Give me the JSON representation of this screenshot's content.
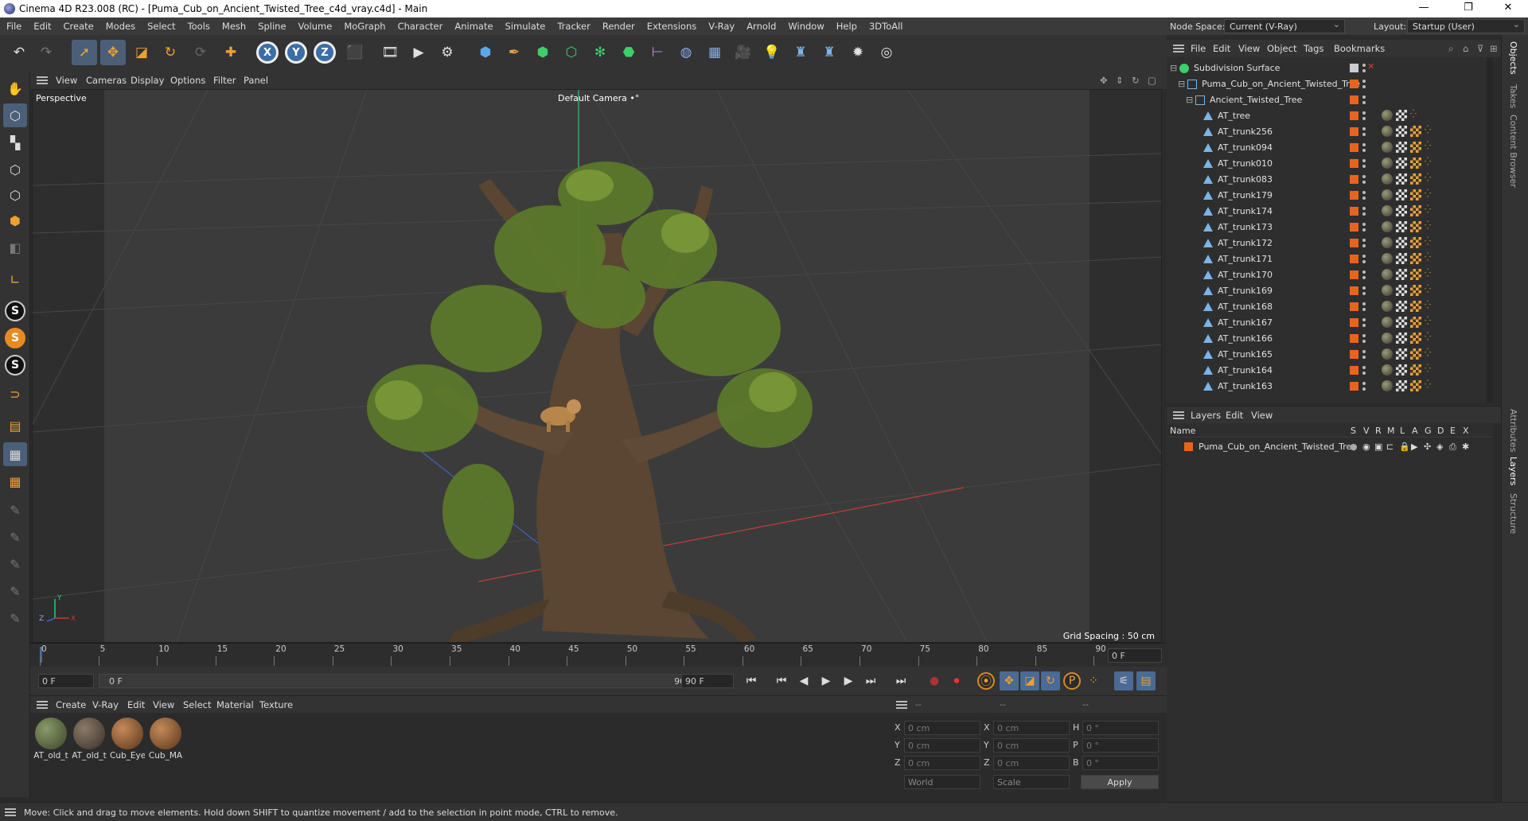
{
  "window": {
    "title": "Cinema 4D R23.008 (RC) - [Puma_Cub_on_Ancient_Twisted_Tree_c4d_vray.c4d] - Main",
    "minimize": "—",
    "maximize": "❐",
    "close": "✕"
  },
  "menu": [
    "File",
    "Edit",
    "Create",
    "Modes",
    "Select",
    "Tools",
    "Mesh",
    "Spline",
    "Volume",
    "MoGraph",
    "Character",
    "Animate",
    "Simulate",
    "Tracker",
    "Render",
    "Extensions",
    "V-Ray",
    "Arnold",
    "Window",
    "Help",
    "3DToAll"
  ],
  "nodespace": {
    "label": "Node Space:",
    "value": "Current (V-Ray)",
    "layout_label": "Layout:",
    "layout_value": "Startup (User)"
  },
  "viewport": {
    "menu": [
      "View",
      "Cameras",
      "Display",
      "Options",
      "Filter",
      "Panel"
    ],
    "view_name": "Perspective",
    "camera": "Default Camera",
    "camera_icon": "•°",
    "grid_spacing": "Grid Spacing : 50 cm",
    "axes": {
      "x": "X",
      "y": "Y",
      "z": "Z"
    },
    "nav_icons": [
      "move-icon",
      "up-down-icon",
      "rotate-icon",
      "maximize-icon"
    ]
  },
  "timeline": {
    "ticks": [
      "0",
      "5",
      "10",
      "15",
      "20",
      "25",
      "30",
      "35",
      "40",
      "45",
      "50",
      "55",
      "60",
      "65",
      "70",
      "75",
      "80",
      "85",
      "90"
    ],
    "end_field": "0 F"
  },
  "playbar": {
    "current": "0 F",
    "range_start": "0 F",
    "range_end": "90 F",
    "max": "90 F"
  },
  "materials": {
    "menu": [
      "Create",
      "V-Ray",
      "Edit",
      "View",
      "Select",
      "Material",
      "Texture"
    ],
    "items": [
      {
        "label": "AT_old_t",
        "color": "#5a6a48"
      },
      {
        "label": "AT_old_t",
        "color": "#5c4a3a"
      },
      {
        "label": "Cub_Eye",
        "color": "#8a5a34"
      },
      {
        "label": "Cub_MA",
        "color": "#8a5a34"
      }
    ]
  },
  "coords": {
    "header": [
      "--",
      "--",
      "--"
    ],
    "rows": [
      {
        "l1": "X",
        "v1": "0 cm",
        "l2": "X",
        "v2": "0 cm",
        "l3": "H",
        "v3": "0 °"
      },
      {
        "l1": "Y",
        "v1": "0 cm",
        "l2": "Y",
        "v2": "0 cm",
        "l3": "P",
        "v3": "0 °"
      },
      {
        "l1": "Z",
        "v1": "0 cm",
        "l2": "Z",
        "v2": "0 cm",
        "l3": "B",
        "v3": "0 °"
      }
    ],
    "space": "World",
    "mode": "Scale",
    "apply": "Apply"
  },
  "status": "Move: Click and drag to move elements. Hold down SHIFT to quantize movement / add to the selection in point mode, CTRL to remove.",
  "objects": {
    "menu": [
      "File",
      "Edit",
      "View",
      "Object",
      "Tags",
      "Bookmarks"
    ],
    "root": "Subdivision Surface",
    "group": "Puma_Cub_on_Ancient_Twisted_Tree",
    "subgroup": "Ancient_Twisted_Tree",
    "items": [
      "AT_tree",
      "AT_trunk256",
      "AT_trunk094",
      "AT_trunk010",
      "AT_trunk083",
      "AT_trunk179",
      "AT_trunk174",
      "AT_trunk173",
      "AT_trunk172",
      "AT_trunk171",
      "AT_trunk170",
      "AT_trunk169",
      "AT_trunk168",
      "AT_trunk167",
      "AT_trunk166",
      "AT_trunk165",
      "AT_trunk164",
      "AT_trunk163"
    ]
  },
  "layers": {
    "menu": [
      "Layers",
      "Edit",
      "View"
    ],
    "name_col": "Name",
    "cols": [
      "S",
      "V",
      "R",
      "M",
      "L",
      "A",
      "G",
      "D",
      "E",
      "X"
    ],
    "row": "Puma_Cub_on_Ancient_Twisted_Tree"
  },
  "right_tabs": [
    "Objects",
    "Takes",
    "Content Browser",
    "Attributes",
    "Layers",
    "Structure"
  ],
  "colors": {
    "accent": "#e8641e",
    "selection": "#4b6078",
    "grid_x": "#c43c3c",
    "grid_y": "#3ac46e",
    "grid_z": "#3c64c4"
  }
}
